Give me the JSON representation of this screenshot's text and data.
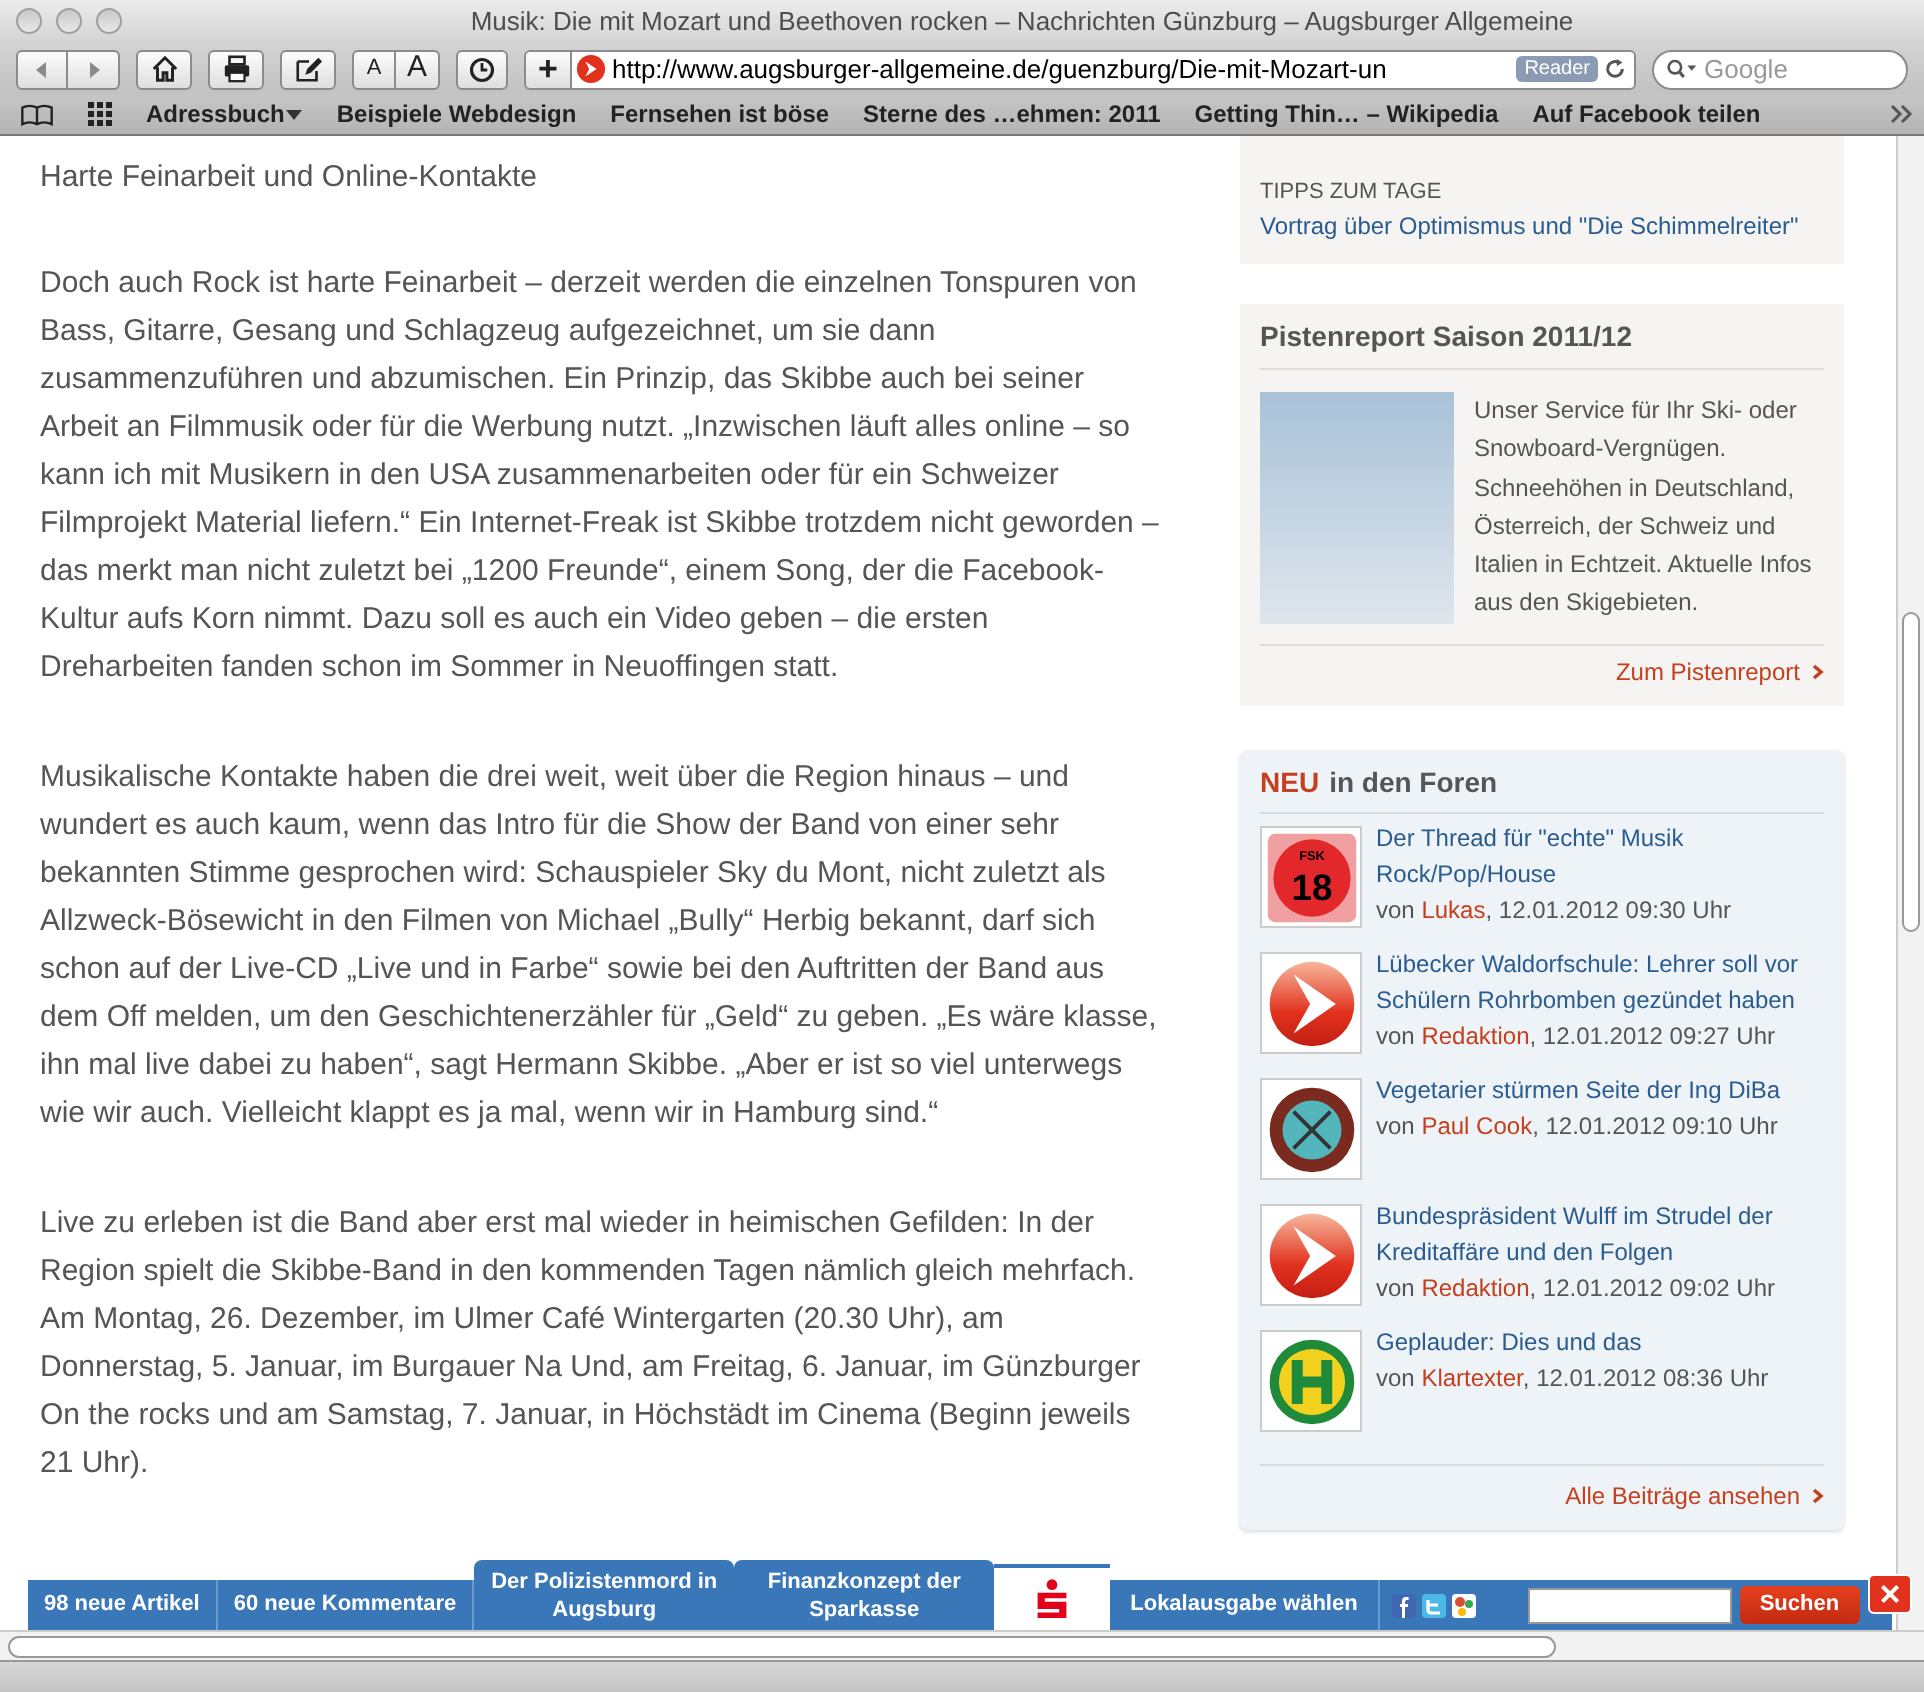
{
  "window": {
    "title": "Musik: Die mit Mozart und Beethoven rocken – Nachrichten Günzburg – Augsburger Allgemeine"
  },
  "toolbar": {
    "font_small": "A",
    "font_large": "A",
    "add": "+",
    "url": "http://www.augsburger-allgemeine.de/guenzburg/Die-mit-Mozart-un",
    "reader": "Reader",
    "search_placeholder": "Google"
  },
  "bookmarks": [
    {
      "label": "Adressbuch",
      "menu": true
    },
    {
      "label": "Beispiele Webdesign",
      "menu": false
    },
    {
      "label": "Fernsehen ist böse",
      "menu": false
    },
    {
      "label": "Sterne des …ehmen: 2011",
      "menu": false
    },
    {
      "label": "Getting Thin… – Wikipedia",
      "menu": false
    },
    {
      "label": "Auf Facebook teilen",
      "menu": false
    }
  ],
  "article": {
    "subheading": "Harte Feinarbeit und Online-Kontakte",
    "paragraphs": [
      "Doch auch Rock ist harte Feinarbeit – derzeit werden die einzelnen Tonspuren von Bass, Gitarre, Gesang und Schlagzeug aufgezeichnet, um sie dann zusammenzuführen und abzumischen. Ein Prinzip, das Skibbe auch bei seiner Arbeit an Filmmusik oder für die Werbung nutzt. „Inzwischen läuft alles online – so kann ich mit Musikern in den USA zusammenarbeiten oder für ein Schweizer Filmprojekt Material liefern.“ Ein Internet-Freak ist Skibbe trotzdem nicht geworden – das merkt man nicht zuletzt bei „1200 Freunde“, einem Song, der die Facebook-Kultur aufs Korn nimmt. Dazu soll es auch ein Video geben – die ersten Dreharbeiten fanden schon im Sommer in Neuoffingen statt.",
      "Musikalische Kontakte haben die drei weit, weit über  die Region hinaus – und wundert es auch kaum, wenn das Intro für die Show der Band von einer sehr bekannten Stimme gesprochen wird: Schauspieler Sky du Mont, nicht zuletzt als Allzweck-Bösewicht in den Filmen von Michael „Bully“ Herbig bekannt, darf sich schon auf der Live-CD „Live und in Farbe“ sowie bei den Auftritten der Band aus dem Off melden, um den Geschichtenerzähler für „Geld“ zu geben. „Es wäre klasse, ihn mal live dabei zu haben“, sagt Hermann Skibbe. „Aber er ist so viel unterwegs wie wir auch. Vielleicht klappt es ja mal, wenn wir in Hamburg sind.“",
      "Live zu erleben ist die Band aber erst mal wieder in heimischen Gefilden: In der Region spielt die Skibbe-Band in den kommenden Tagen nämlich gleich mehrfach. Am Montag, 26. Dezember, im Ulmer Café Wintergarten (20.30 Uhr), am Donnerstag, 5. Januar, im Burgauer Na Und, am Freitag, 6. Januar, im Günzburger On the rocks und am Samstag, 7. Januar, in Höchstädt im Cinema (Beginn jeweils 21 Uhr)."
    ]
  },
  "tips": {
    "label": "TIPPS ZUM TAGE",
    "link": "Vortrag über Optimismus und \"Die Schimmelreiter\""
  },
  "pistenreport": {
    "title": "Pistenreport Saison 2011/12",
    "text": "Unser Service für Ihr Ski- oder Snowboard-Vergnügen. Schneehöhen in Deutschland, Österreich, der Schweiz und Italien in Echtzeit. Aktuelle Infos aus den Skigebieten.",
    "link": "Zum Pistenreport"
  },
  "forum": {
    "title_highlight": "NEU",
    "title_rest": "in den Foren",
    "more": "Alle Beiträge ansehen",
    "posts": [
      {
        "kind": "fsk",
        "icon_label": "FSK",
        "icon_number": "18",
        "title": "Der Thread für \"echte\" Musik Rock/Pop/House",
        "by": "von",
        "author": "Lukas",
        "time": ", 12.01.2012 09:30 Uhr"
      },
      {
        "kind": "arrow",
        "title": "Lübecker Waldorfschule: Lehrer soll vor Schülern Rohrbomben gezündet haben",
        "by": "von",
        "author": "Redaktion",
        "time": ", 12.01.2012 09:27 Uhr"
      },
      {
        "kind": "emblem",
        "title": "Vegetarier stürmen Seite der Ing DiBa",
        "by": "von",
        "author": "Paul Cook",
        "time": ", 12.01.2012 09:10 Uhr"
      },
      {
        "kind": "arrow",
        "title": "Bundespräsident Wulff im Strudel der Kreditaffäre und den Folgen",
        "by": "von",
        "author": "Redaktion",
        "time": ", 12.01.2012 09:02 Uhr"
      },
      {
        "kind": "stop",
        "title": "Geplauder: Dies und das",
        "by": "von",
        "author": "Klartexter",
        "time": ", 12.01.2012 08:36 Uhr"
      }
    ]
  },
  "site_bar": {
    "items": [
      {
        "label": "98 neue Artikel",
        "raised": false
      },
      {
        "label": "60 neue Kommentare",
        "raised": false
      },
      {
        "label": "Der Polizistenmord in Augsburg",
        "raised": true
      },
      {
        "label": "Finanzkonzept der Sparkasse",
        "raised": true
      }
    ],
    "local": "Lokalausgabe wählen",
    "search_button": "Suchen",
    "close": "×"
  }
}
